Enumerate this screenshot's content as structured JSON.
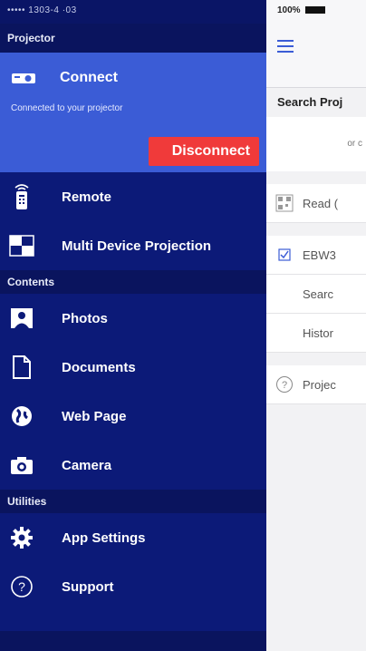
{
  "status_left": "••••• 1303-4 ·03",
  "drawer": {
    "projector_header": "Projector",
    "connect_label": "Connect",
    "connected_text": "Connected to your projector",
    "disconnect_label": "Disconnect",
    "remote_label": "Remote",
    "multi_label": "Multi Device Projection",
    "contents_header": "Contents",
    "photos_label": "Photos",
    "documents_label": "Documents",
    "webpage_label": "Web Page",
    "camera_label": "Camera",
    "utilities_header": "Utilities",
    "settings_label": "App Settings",
    "support_label": "Support"
  },
  "content": {
    "battery": "100%",
    "search_title": "Search Proj",
    "or_text": "or c",
    "read_label": "Read (",
    "device_name": "EBW3",
    "search_item": "Searc",
    "history_item": "Histor",
    "projector_item": "Projec"
  },
  "colors": {
    "drawer_bg": "#0c1a78",
    "connect_bg": "#3b5cd6",
    "disconnect_bg": "#f03a3a",
    "accent": "#3b5cd6"
  }
}
